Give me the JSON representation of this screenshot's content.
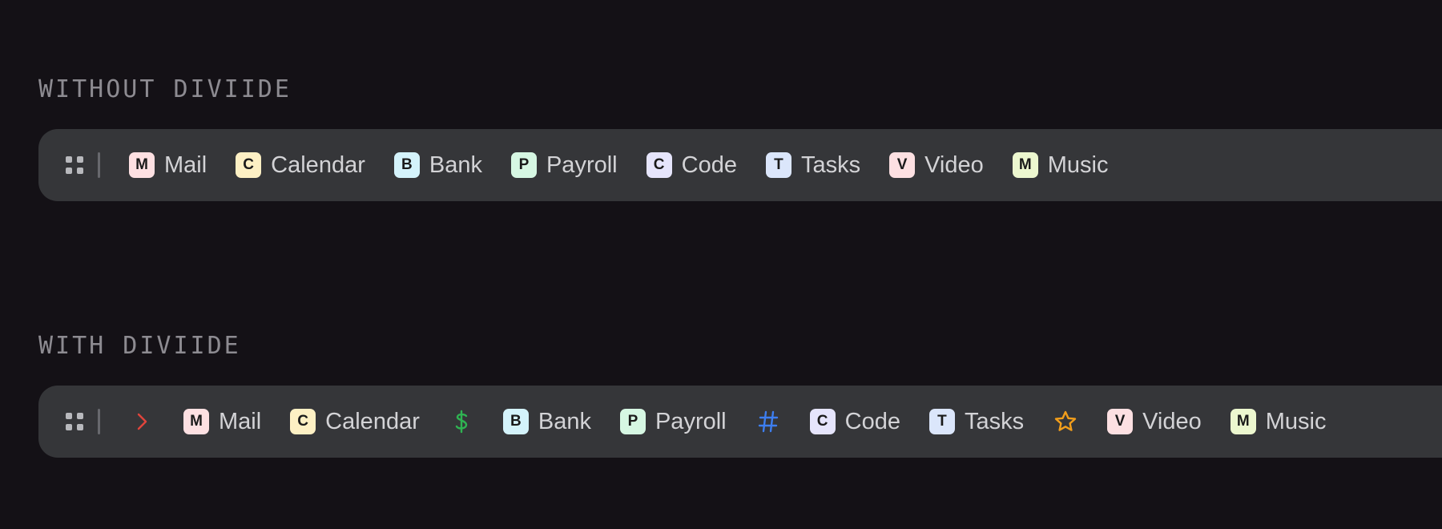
{
  "sections": [
    {
      "title": "WITHOUT DIVIIDE",
      "items": [
        {
          "letter": "M",
          "label": "Mail",
          "color": "#fde0e2"
        },
        {
          "letter": "C",
          "label": "Calendar",
          "color": "#fdf0c4"
        },
        {
          "letter": "B",
          "label": "Bank",
          "color": "#d4f3fb"
        },
        {
          "letter": "P",
          "label": "Payroll",
          "color": "#d6f7e3"
        },
        {
          "letter": "C",
          "label": "Code",
          "color": "#e6e5fc"
        },
        {
          "letter": "T",
          "label": "Tasks",
          "color": "#dbe6fb"
        },
        {
          "letter": "V",
          "label": "Video",
          "color": "#fde0e2"
        },
        {
          "letter": "M",
          "label": "Music",
          "color": "#ecf7cf"
        }
      ]
    },
    {
      "title": "WITH DIVIIDE",
      "leading_divider": {
        "icon": "chevron-right-icon",
        "color": "#e0443c"
      },
      "items": [
        {
          "letter": "M",
          "label": "Mail",
          "color": "#fde0e2"
        },
        {
          "letter": "C",
          "label": "Calendar",
          "color": "#fdf0c4"
        },
        {
          "divider": true,
          "icon": "dollar-icon",
          "color": "#2fb352"
        },
        {
          "letter": "B",
          "label": "Bank",
          "color": "#d4f3fb"
        },
        {
          "letter": "P",
          "label": "Payroll",
          "color": "#d6f7e3"
        },
        {
          "divider": true,
          "icon": "hash-icon",
          "color": "#3d7ef0"
        },
        {
          "letter": "C",
          "label": "Code",
          "color": "#e6e5fc"
        },
        {
          "letter": "T",
          "label": "Tasks",
          "color": "#dbe6fb"
        },
        {
          "divider": true,
          "icon": "star-icon",
          "color": "#f29e1b"
        },
        {
          "letter": "V",
          "label": "Video",
          "color": "#fde0e2"
        },
        {
          "letter": "M",
          "label": "Music",
          "color": "#ecf7cf"
        }
      ]
    }
  ]
}
